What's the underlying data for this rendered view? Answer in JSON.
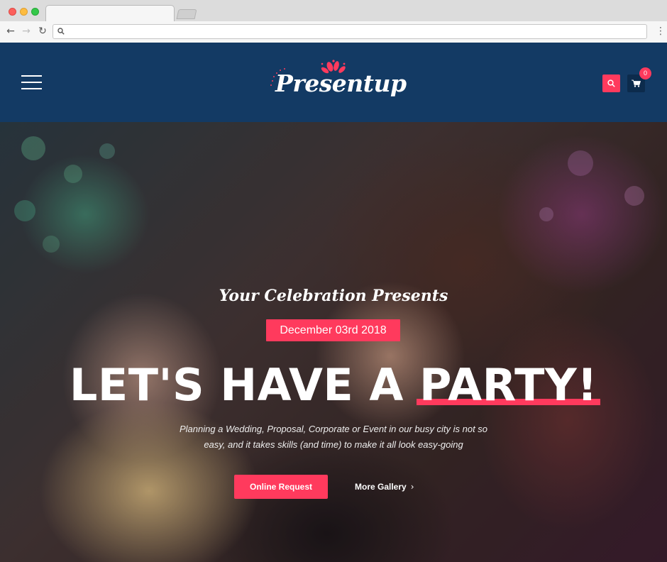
{
  "browser": {
    "url": "",
    "menu_icon": "⋮",
    "back_icon": "←",
    "forward_icon": "→",
    "reload_icon": "↻"
  },
  "header": {
    "brand": "Presentup",
    "cart_count": "0",
    "colors": {
      "background": "#133a64",
      "accent": "#ff3a5d"
    }
  },
  "hero": {
    "kicker": "Your Celebration Presents",
    "date": "December 03rd 2018",
    "headline_prefix": "LET'S HAVE A ",
    "headline_highlight": "PARTY!",
    "description": "Planning a Wedding, Proposal, Corporate or Event in our busy city is not so easy, and it takes skills (and time) to make it all look easy-going",
    "primary_button": "Online Request",
    "secondary_button": "More Gallery",
    "secondary_icon": "›"
  }
}
